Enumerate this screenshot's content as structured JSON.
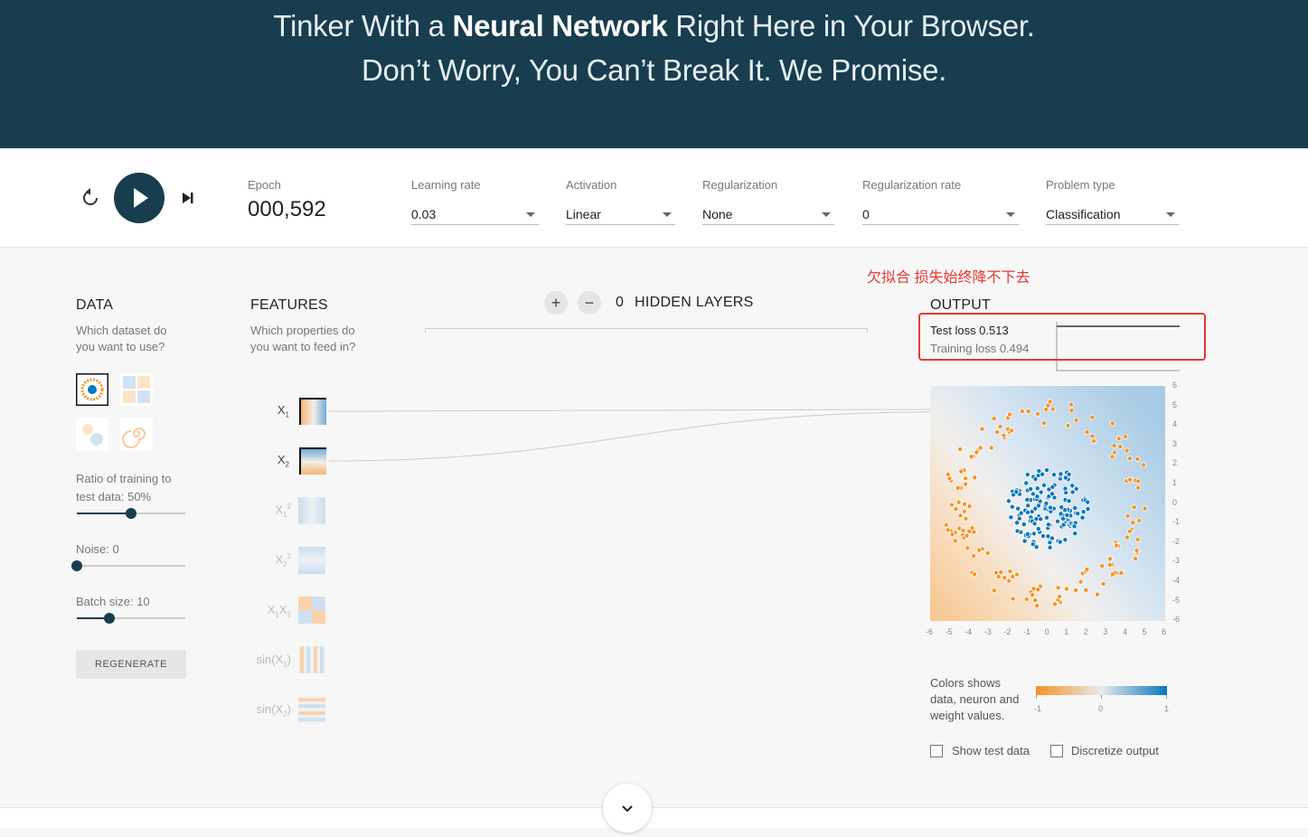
{
  "hero": {
    "line1_pre": "Tinker With a ",
    "line1_bold": "Neural Network",
    "line1_post": " Right Here in Your Browser.",
    "line2": "Don’t Worry, You Can’t Break It. We Promise."
  },
  "controls": {
    "epoch_label": "Epoch",
    "epoch_value": "000,592",
    "learning_rate_label": "Learning rate",
    "learning_rate_value": "0.03",
    "activation_label": "Activation",
    "activation_value": "Linear",
    "regularization_label": "Regularization",
    "regularization_value": "None",
    "regularization_rate_label": "Regularization rate",
    "regularization_rate_value": "0",
    "problem_type_label": "Problem type",
    "problem_type_value": "Classification"
  },
  "data_panel": {
    "title": "DATA",
    "subtitle_1": "Which dataset do",
    "subtitle_2": "you want to use?",
    "ratio_label": "Ratio of training to",
    "ratio_label_2": "test data:  50%",
    "ratio_value": 0.5,
    "noise_label": "Noise:  0",
    "noise_value": 0,
    "batch_label": "Batch size:  10",
    "batch_value": 0.3,
    "regenerate": "REGENERATE"
  },
  "features_panel": {
    "title": "FEATURES",
    "subtitle_1": "Which properties do",
    "subtitle_2": "you want to feed in?"
  },
  "hidden_layers": {
    "plus": "+",
    "minus": "−",
    "count": "0",
    "label": "HIDDEN LAYERS"
  },
  "annotation": {
    "text": "欠拟合 损失始终降不下去",
    "color": "#e53935"
  },
  "output_panel": {
    "title": "OUTPUT",
    "test_loss": "Test loss 0.513",
    "training_loss": "Training loss 0.494",
    "y_ticks": [
      "6",
      "5",
      "4",
      "3",
      "2",
      "1",
      "0",
      "-1",
      "-2",
      "-3",
      "-4",
      "-5",
      "-6"
    ],
    "x_ticks": [
      "-6",
      "-5",
      "-4",
      "-3",
      "-2",
      "-1",
      "0",
      "1",
      "2",
      "3",
      "4",
      "5",
      "6"
    ],
    "legend_text_1": "Colors shows",
    "legend_text_2": "data, neuron and",
    "legend_text_3": "weight values.",
    "legend_min": "-1",
    "legend_mid": "0",
    "legend_max": "1",
    "show_test_data": "Show test data",
    "discretize_output": "Discretize output"
  },
  "colors": {
    "dark_blue": "#183d4e",
    "orange": "#f59322",
    "blue": "#0877bd"
  }
}
